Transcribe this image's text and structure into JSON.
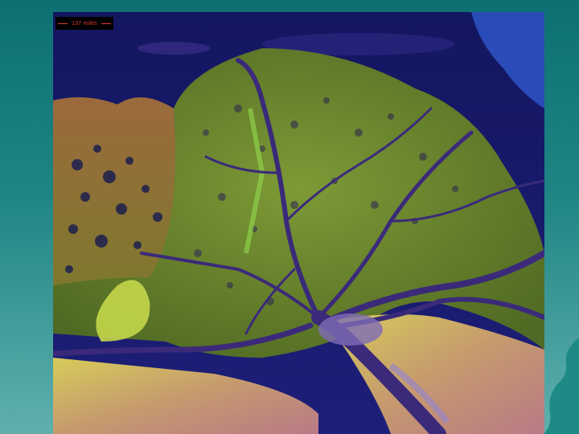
{
  "slide": {
    "image": {
      "kind": "satellite false-color image of a river delta",
      "scale_label": "137 miles"
    }
  },
  "colors": {
    "background_top": "#0d6f72",
    "background_bottom": "#5fb0ad",
    "sea": "#141a66",
    "land_green": "#6f8a2e",
    "channel": "#3b2a7a",
    "scale_text": "#e63b2e"
  }
}
